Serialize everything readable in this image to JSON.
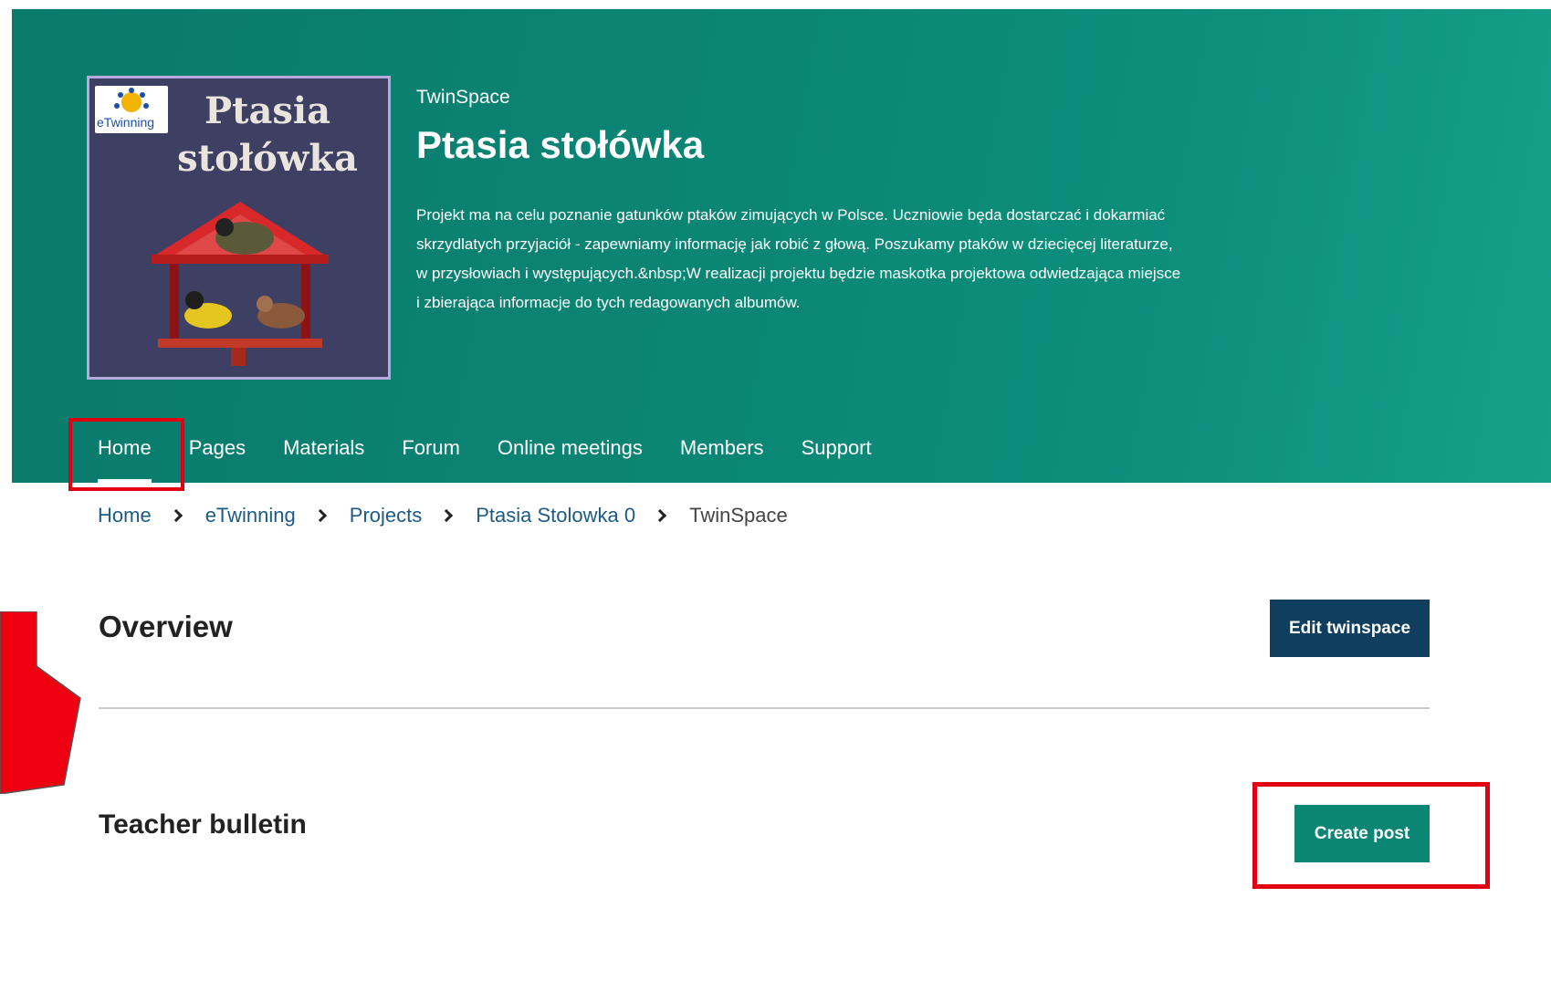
{
  "colors": {
    "banner_teal": "#0b8574",
    "edit_button": "#0f3e5e",
    "create_button": "#0b8574",
    "highlight_red": "#e00012",
    "link_blue": "#1c5b86"
  },
  "logo": {
    "badge_text": "eTwinning",
    "title_line1": "Ptasia",
    "title_line2": "stołówka"
  },
  "header": {
    "label": "TwinSpace",
    "title": "Ptasia stołówka",
    "description": "Projekt ma na celu poznanie gatunków ptaków zimujących w Polsce. Uczniowie będa dostarczać i dokarmiać skrzydlatych przyjaciół - zapewniamy informację jak robić z głową. Poszukamy ptaków w dziecięcej literaturze, w przysłowiach i występujących.&nbsp;W realizacji projektu będzie maskotka projektowa odwiedzająca miejsce i zbierająca informacje do tych redagowanych albumów."
  },
  "nav": {
    "items": [
      {
        "label": "Home",
        "active": true
      },
      {
        "label": "Pages"
      },
      {
        "label": "Materials"
      },
      {
        "label": "Forum"
      },
      {
        "label": "Online meetings"
      },
      {
        "label": "Members"
      },
      {
        "label": "Support"
      }
    ]
  },
  "breadcrumb": {
    "items": [
      "Home",
      "eTwinning",
      "Projects",
      "Ptasia Stolowka 0",
      "TwinSpace"
    ]
  },
  "overview": {
    "title": "Overview",
    "edit_button": "Edit twinspace"
  },
  "bulletin": {
    "title": "Teacher bulletin",
    "create_button": "Create post"
  }
}
